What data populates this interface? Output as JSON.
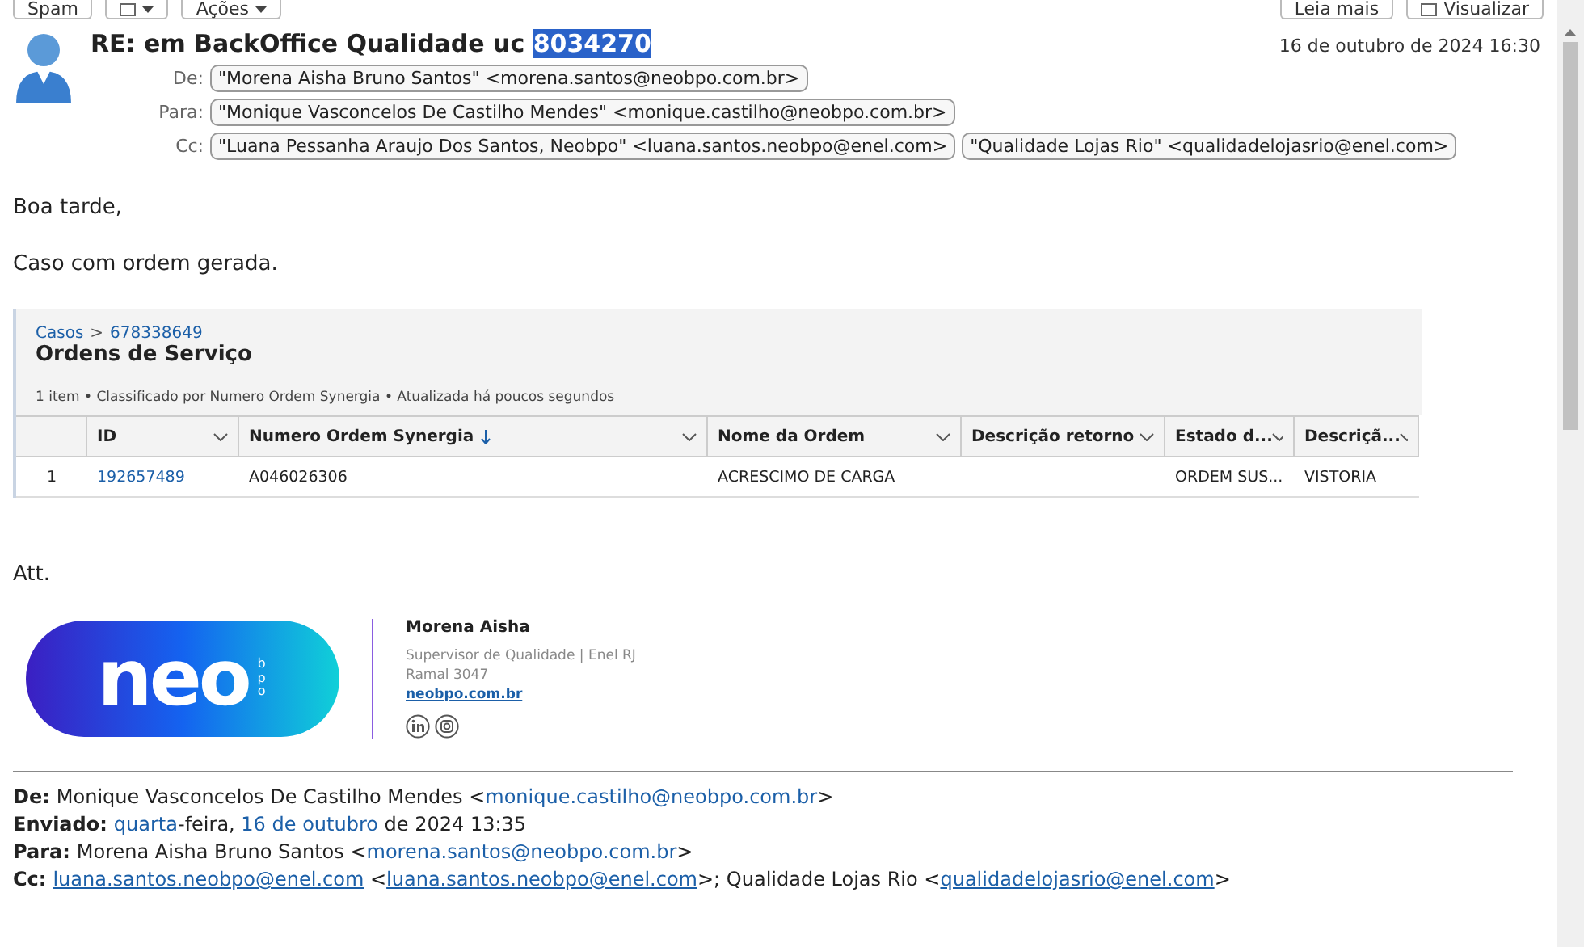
{
  "toolbar": {
    "left": [
      {
        "kind": "text",
        "label": "Spam"
      },
      {
        "kind": "icon-menu"
      },
      {
        "kind": "menu",
        "label": "Ações"
      }
    ],
    "right": [
      {
        "kind": "text",
        "label": "Leia mais"
      },
      {
        "kind": "icon-text",
        "label": "Visualizar"
      }
    ]
  },
  "message": {
    "subject_prefix": "RE: em BackOffice Qualidade uc ",
    "subject_selected": "8034270",
    "date": "16 de outubro de 2024 16:30",
    "headers": [
      {
        "label": "De:",
        "recipients": [
          "\"Morena Aisha Bruno Santos\" <morena.santos@neobpo.com.br>"
        ]
      },
      {
        "label": "Para:",
        "recipients": [
          "\"Monique Vasconcelos De Castilho Mendes\" <monique.castilho@neobpo.com.br>"
        ]
      },
      {
        "label": "Cc:",
        "recipients": [
          "\"Luana Pessanha Araujo Dos Santos, Neobpo\" <luana.santos.neobpo@enel.com>",
          "\"Qualidade Lojas Rio\" <qualidadelojasrio@enel.com>"
        ]
      }
    ]
  },
  "body": {
    "greeting": "Boa tarde,",
    "text": "Caso com ordem gerada.",
    "closing": "Att."
  },
  "record": {
    "breadcrumb": [
      "Casos",
      "678338649"
    ],
    "separator": ">",
    "title": "Ordens de Serviço",
    "meta": "1 item • Classificado por Numero Ordem Synergia • Atualizada há poucos segundos",
    "columns": [
      {
        "label": "ID",
        "sorted": false
      },
      {
        "label": "Numero Ordem Synergia",
        "sorted": true
      },
      {
        "label": "Nome da Ordem",
        "sorted": false
      },
      {
        "label": "Descrição retorno",
        "sorted": false
      },
      {
        "label": "Estado d...",
        "sorted": false
      },
      {
        "label": "Descriçã...",
        "sorted": false
      }
    ],
    "rows": [
      {
        "number": "1",
        "cells": [
          "192657489",
          "A046026306",
          "ACRESCIMO DE CARGA",
          "",
          "ORDEM SUS...",
          "VISTORIA"
        ]
      }
    ]
  },
  "signature": {
    "logo_main": "neo",
    "logo_sub": "bpo",
    "name": "Morena Aisha",
    "role": "Supervisor de Qualidade | Enel RJ",
    "extension": "Ramal 3047",
    "site": "neobpo.com.br"
  },
  "quoted": [
    {
      "label": "De:",
      "parts": [
        {
          "text": "Monique Vasconcelos De Castilho Mendes <",
          "link": false
        },
        {
          "text": "monique.castilho@neobpo.com.br",
          "link": true
        },
        {
          "text": ">",
          "link": false
        }
      ]
    },
    {
      "label": "Enviado:",
      "parts": [
        {
          "text": "quarta",
          "link": true
        },
        {
          "text": "-feira, ",
          "link": false
        },
        {
          "text": "16 de outubro",
          "link": true
        },
        {
          "text": " de 2024 13:35",
          "link": false
        }
      ]
    },
    {
      "label": "Para:",
      "parts": [
        {
          "text": "Morena Aisha Bruno Santos <",
          "link": false
        },
        {
          "text": "morena.santos@neobpo.com.br",
          "link": true
        },
        {
          "text": ">",
          "link": false
        }
      ]
    },
    {
      "label": "Cc:",
      "parts": [
        {
          "text": "luana.santos.neobpo@enel.com",
          "link": true
        },
        {
          "text": " <",
          "link": false
        },
        {
          "text": "luana.santos.neobpo@enel.com",
          "link": true
        },
        {
          "text": ">; Qualidade Lojas Rio <",
          "link": false
        },
        {
          "text": "qualidadelojasrio@enel.com",
          "link": true
        },
        {
          "text": ">",
          "link": false
        }
      ]
    }
  ]
}
